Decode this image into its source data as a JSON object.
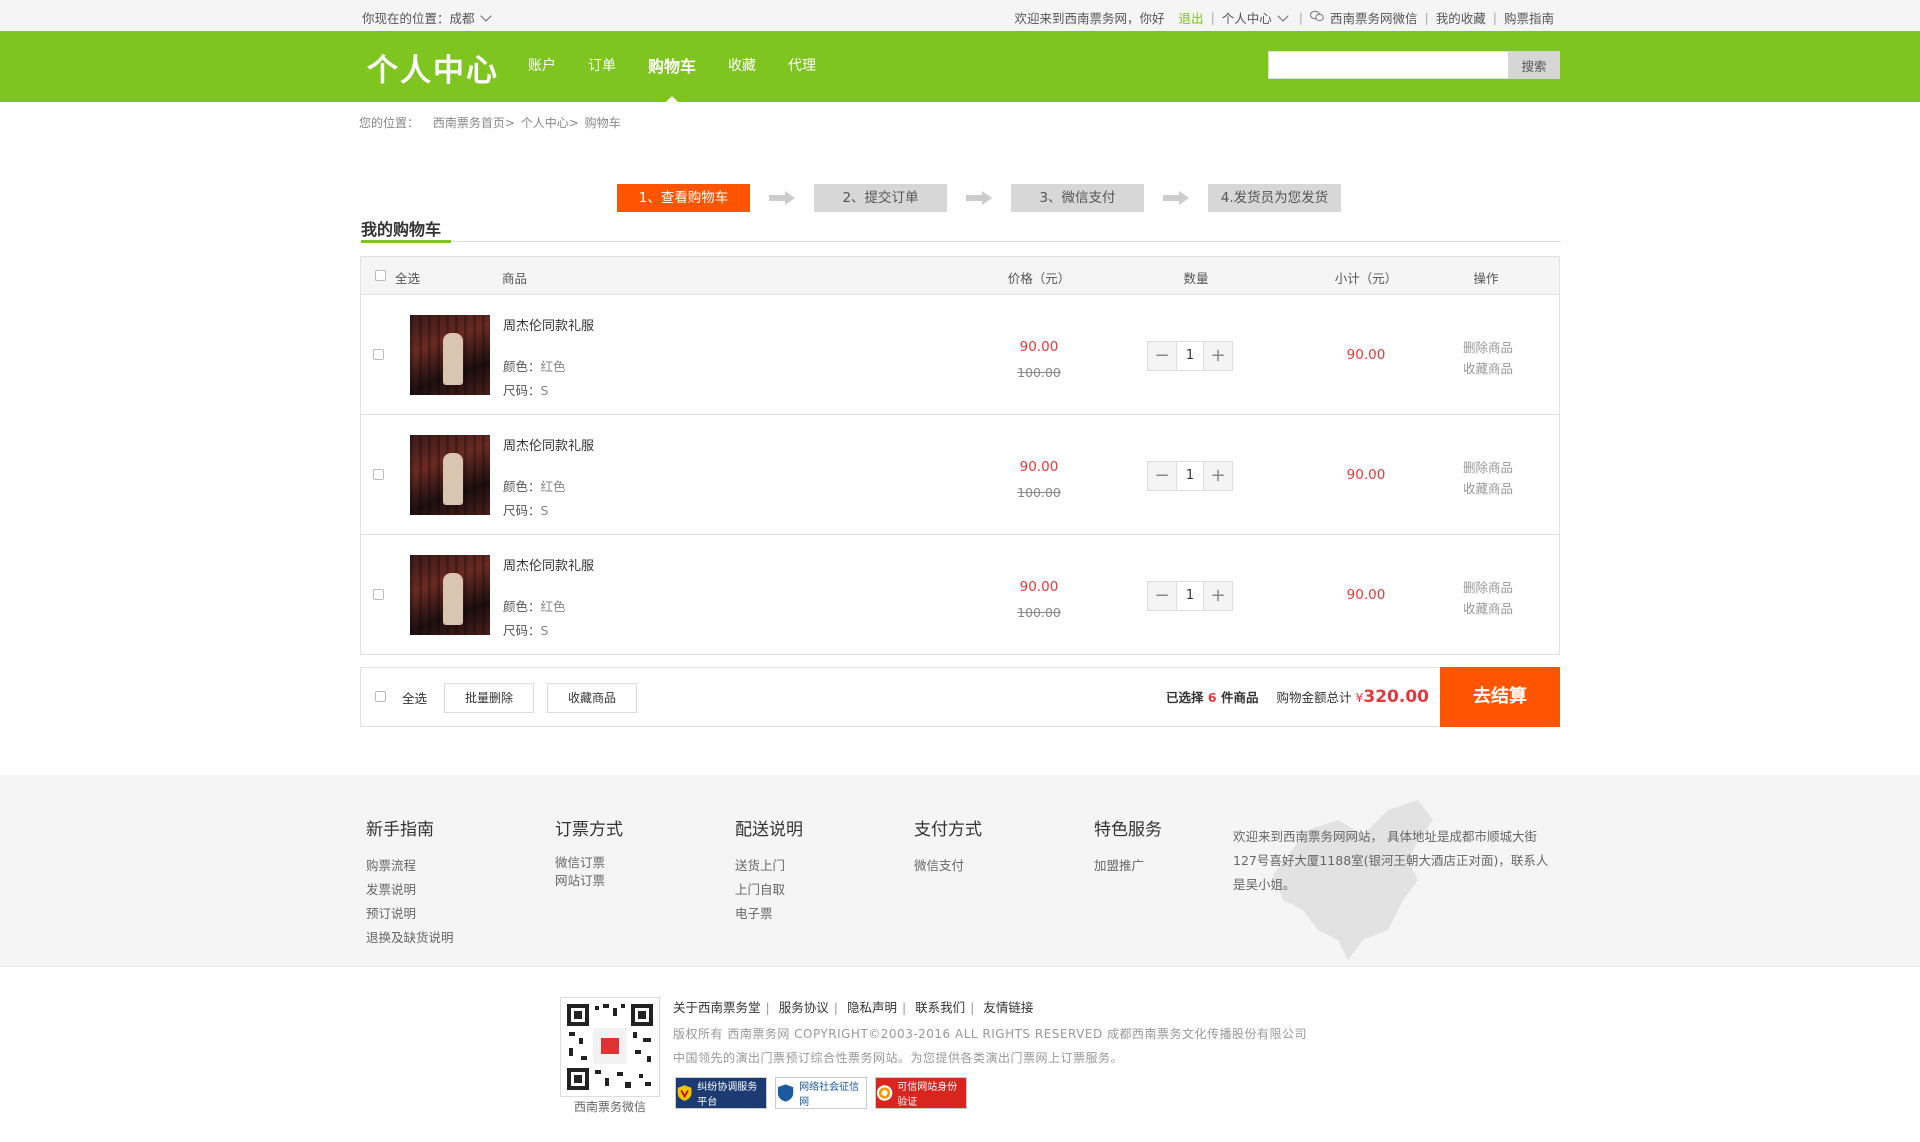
{
  "topbar": {
    "location": "你现在的位置：成都",
    "welcome": "欢迎来到西南票务网，你好",
    "logout": "退出",
    "user_center": "个人中心",
    "wechat": "西南票务网微信",
    "favorites": "我的收藏",
    "guide": "购票指南"
  },
  "header": {
    "logo": "个人中心",
    "nav": [
      "账户",
      "订单",
      "购物车",
      "收藏",
      "代理"
    ],
    "active_nav": "购物车",
    "search_button": "搜索",
    "search_value": ""
  },
  "breadcrumb": [
    "您的位置：",
    "西南票务首页",
    ">",
    "个人中心",
    ">",
    "购物车"
  ],
  "steps": [
    "1、查看购物车",
    "2、提交订单",
    "3、微信支付",
    "4.发货员为您发货"
  ],
  "page_title": "我的购物车",
  "cart": {
    "headers": {
      "select_all": "全选",
      "product": "商品",
      "price": "价格（元）",
      "qty": "数量",
      "subtotal": "小计（元）",
      "ops": "操作"
    },
    "items": [
      {
        "name": "周杰伦同款礼服",
        "color_label": "颜色：",
        "color": "红色",
        "size_label": "尺码：",
        "size": "S",
        "price": "90.00",
        "original_price": "100.00",
        "qty": "1",
        "subtotal": "90.00",
        "delete": "删除商品",
        "favorite": "收藏商品"
      },
      {
        "name": "周杰伦同款礼服",
        "color_label": "颜色：",
        "color": "红色",
        "size_label": "尺码：",
        "size": "S",
        "price": "90.00",
        "original_price": "100.00",
        "qty": "1",
        "subtotal": "90.00",
        "delete": "删除商品",
        "favorite": "收藏商品"
      },
      {
        "name": "周杰伦同款礼服",
        "color_label": "颜色：",
        "color": "红色",
        "size_label": "尺码：",
        "size": "S",
        "price": "90.00",
        "original_price": "100.00",
        "qty": "1",
        "subtotal": "90.00",
        "delete": "删除商品",
        "favorite": "收藏商品"
      }
    ]
  },
  "summary": {
    "select_all": "全选",
    "batch_delete": "批量删除",
    "favorite": "收藏商品",
    "selected_prefix": "已选择",
    "selected_count": "6",
    "selected_suffix": "件商品",
    "total_label": "购物金额总计",
    "currency": "¥",
    "total": "320.00",
    "checkout": "去结算"
  },
  "footer": {
    "columns": [
      {
        "title": "新手指南",
        "links": [
          "购票流程",
          "发票说明",
          "预订说明",
          "退换及缺货说明"
        ]
      },
      {
        "title": "订票方式",
        "links": [
          "微信订票",
          "网站订票"
        ]
      },
      {
        "title": "配送说明",
        "links": [
          "送货上门",
          "上门自取",
          "电子票"
        ]
      },
      {
        "title": "支付方式",
        "links": [
          "微信支付"
        ]
      },
      {
        "title": "特色服务",
        "links": [
          "加盟推广"
        ]
      }
    ],
    "address": "欢迎来到西南票务网网站， 具体地址是成都市顺城大街127号喜好大厦1188室(银河王朝大酒店正对面)，联系人是吴小姐。"
  },
  "bottom": {
    "qr_label": "西南票务微信",
    "links": [
      "关于西南票务堂",
      "服务协议",
      "隐私声明",
      "联系我们",
      "友情链接"
    ],
    "copyright": "版权所有 西南票务网 COPYRIGHT©2003-2016 ALL RIGHTS RESERVED 成都西南票务文化传播股份有限公司",
    "tagline": "中国领先的演出门票预订综合性票务网站。为您提供各类演出门票网上订票服务。",
    "badges": [
      "纠纷协调服务平台",
      "网络社会征信网",
      "可信网站身份验证"
    ]
  },
  "colors": {
    "brand_green": "#7fc520",
    "accent_orange": "#ff5500",
    "price_red": "#e4393c"
  }
}
